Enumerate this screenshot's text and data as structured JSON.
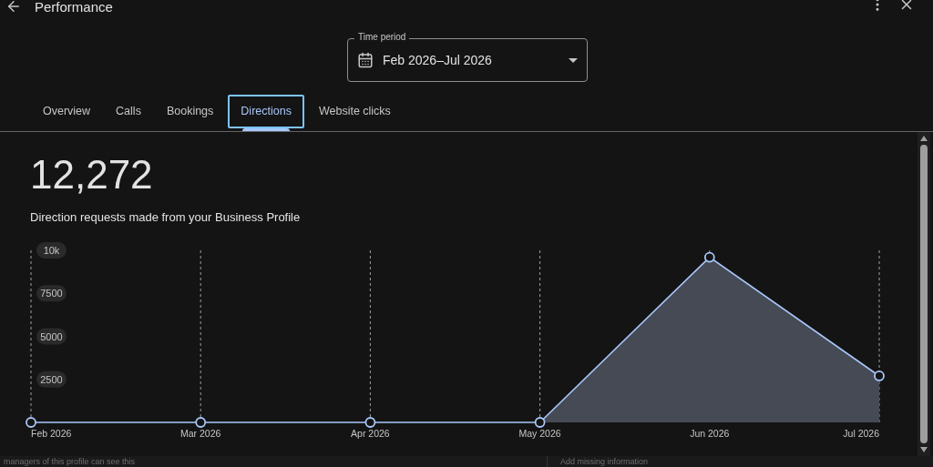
{
  "header": {
    "title": "Performance"
  },
  "time_period": {
    "label": "Time period",
    "value": "Feb 2026–Jul 2026"
  },
  "tabs": [
    {
      "label": "Overview",
      "selected": false
    },
    {
      "label": "Calls",
      "selected": false
    },
    {
      "label": "Bookings",
      "selected": false
    },
    {
      "label": "Directions",
      "selected": true
    },
    {
      "label": "Website clicks",
      "selected": false
    }
  ],
  "metric": {
    "value": "12,272",
    "description": "Direction requests made from your Business Profile"
  },
  "chart_data": {
    "type": "area",
    "categories": [
      "Feb 2026",
      "Mar 2026",
      "Apr 2026",
      "May 2026",
      "Jun 2026",
      "Jul 2026"
    ],
    "grid": true,
    "series": [
      {
        "color": "#a8c7fa",
        "values": [
          0,
          0,
          0,
          0,
          9600,
          2700
        ]
      }
    ],
    "ylim": [
      0,
      10000
    ],
    "yticks": [
      {
        "value": 2500,
        "label": "2500"
      },
      {
        "value": 5000,
        "label": "5000"
      },
      {
        "value": 7500,
        "label": "7500"
      },
      {
        "value": 10000,
        "label": "10k"
      }
    ]
  },
  "footer": {
    "left_text": "managers of this profile can see this",
    "right_text": "Add missing information"
  }
}
